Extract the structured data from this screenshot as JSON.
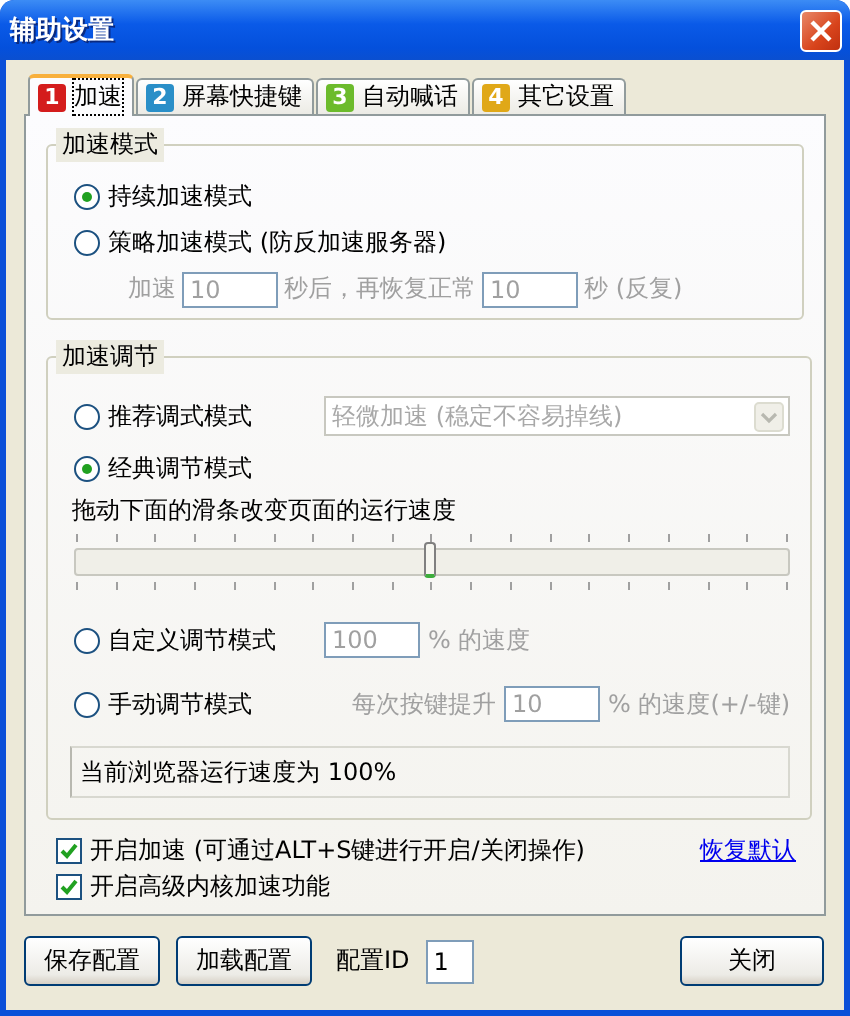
{
  "window": {
    "title": "辅助设置"
  },
  "tabs": [
    {
      "number": "1",
      "label": "加速",
      "selected": true,
      "color": "#d41c1c"
    },
    {
      "number": "2",
      "label": "屏幕快捷键",
      "selected": false,
      "color": "#2a8fc8"
    },
    {
      "number": "3",
      "label": "自动喊话",
      "selected": false,
      "color": "#6cbb2c"
    },
    {
      "number": "4",
      "label": "其它设置",
      "selected": false,
      "color": "#e0a818"
    }
  ],
  "speed_mode": {
    "title": "加速模式",
    "options": [
      {
        "label": "持续加速模式",
        "selected": true
      },
      {
        "label": "策略加速模式 (防反加速服务器)",
        "selected": false
      }
    ],
    "timing": {
      "disabled": true,
      "prefix": "加速",
      "first_value": "10",
      "middle": "秒后，再恢复正常",
      "second_value": "10",
      "suffix": "秒 (反复)"
    }
  },
  "speed_adjust": {
    "title": "加速调节",
    "recommended": {
      "label": "推荐调式模式",
      "selected": false,
      "dropdown_value": "轻微加速 (稳定不容易掉线)",
      "disabled": true
    },
    "classic": {
      "label": "经典调节模式",
      "selected": true,
      "hint": "拖动下面的滑条改变页面的运行速度",
      "level": 0.5
    },
    "custom": {
      "label": "自定义调节模式",
      "selected": false,
      "value": "100",
      "suffix": "% 的速度",
      "disabled": true
    },
    "manual": {
      "label": "手动调节模式",
      "selected": false,
      "prefix": "每次按键提升",
      "value": "10",
      "suffix": "% 的速度(+/-键)",
      "disabled": true
    },
    "status": "当前浏览器运行速度为 100%"
  },
  "checkboxes": [
    {
      "label": "开启加速 (可通过ALT+S键进行开启/关闭操作)",
      "checked": true
    },
    {
      "label": "开启高级内核加速功能",
      "checked": true
    }
  ],
  "restore_link": "恢复默认",
  "footer": {
    "save_button": "保存配置",
    "load_button": "加载配置",
    "config_label": "配置ID",
    "config_value": "1",
    "close_button": "关闭"
  }
}
